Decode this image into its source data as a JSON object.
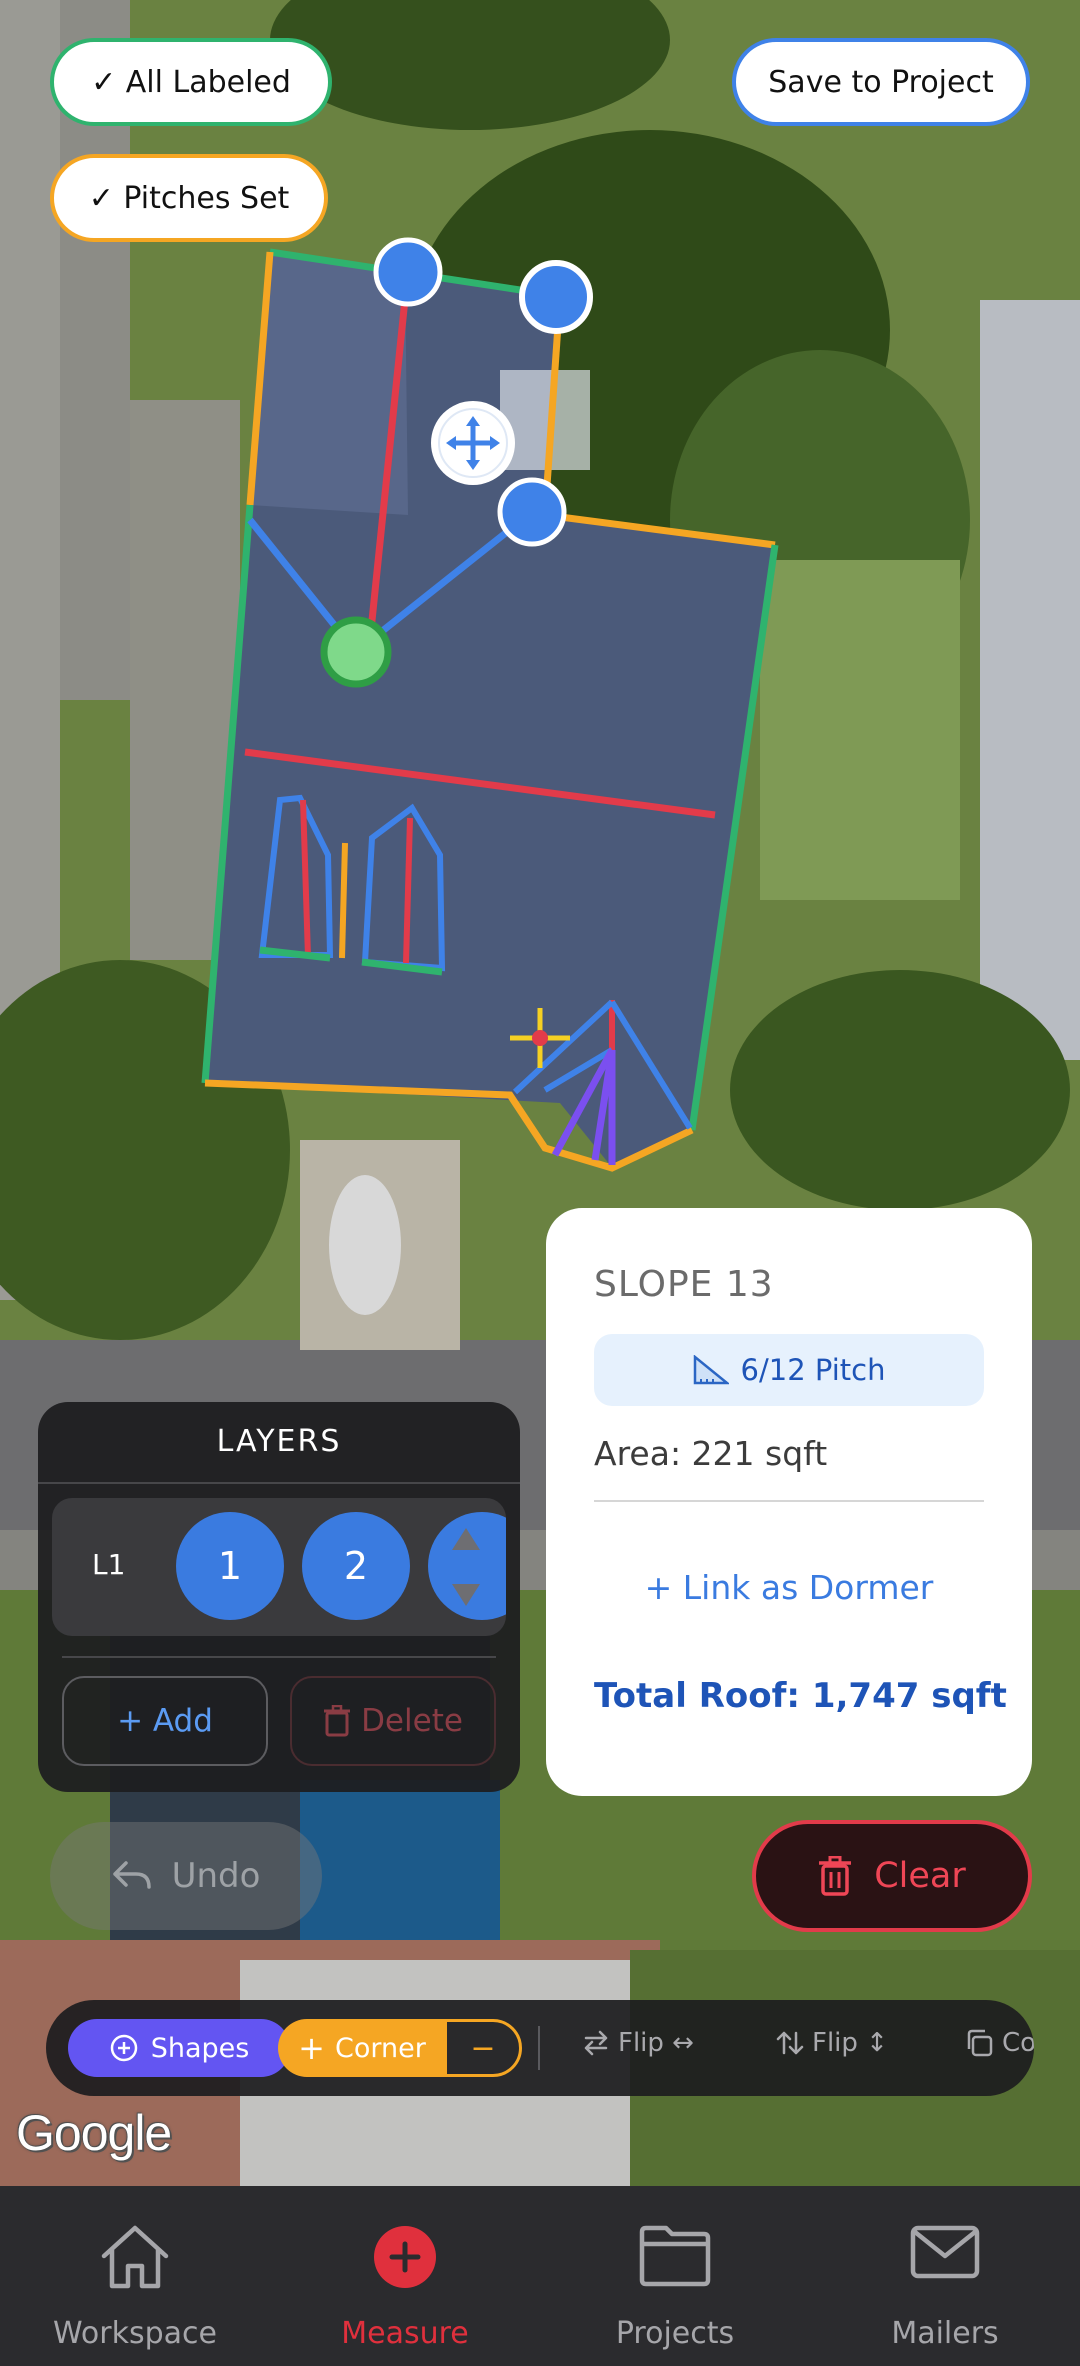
{
  "badges": {
    "all_labeled": "✓ All Labeled",
    "pitches_set": "✓ Pitches Set",
    "save_to_project": "Save to Project"
  },
  "slope_card": {
    "title": "SLOPE 13",
    "pitch": "6/12 Pitch",
    "area": "Area: 221 sqft",
    "link_dormer": "+ Link as Dormer",
    "total_roof": "Total Roof: 1,747 sqft"
  },
  "layers": {
    "title": "LAYERS",
    "row_label": "L1",
    "items": [
      "1",
      "2"
    ],
    "add_label": "+ Add",
    "delete_label": "Delete"
  },
  "actions": {
    "undo_label": "Undo",
    "clear_label": "Clear"
  },
  "toolbar": {
    "shapes_label": "Shapes",
    "corner_label": "Corner",
    "corner_minus": "−",
    "flip_h_label": "Flip ↔",
    "flip_v_label": "Flip ↕",
    "copy_label": "Co"
  },
  "map": {
    "attribution": "Google"
  },
  "nav": {
    "items": [
      {
        "label": "Workspace",
        "icon": "home-icon"
      },
      {
        "label": "Measure",
        "icon": "plus-circle-icon"
      },
      {
        "label": "Projects",
        "icon": "folder-icon"
      },
      {
        "label": "Mailers",
        "icon": "mail-icon"
      }
    ],
    "active": "Measure"
  },
  "colors": {
    "edge_green": "#2fb36e",
    "edge_orange": "#f5a623",
    "edge_red": "#e23b4a",
    "edge_blue": "#3f82e8",
    "edge_purple": "#7b4ff0",
    "accent_red": "#e0303d",
    "accent_blue": "#3a7be0"
  }
}
